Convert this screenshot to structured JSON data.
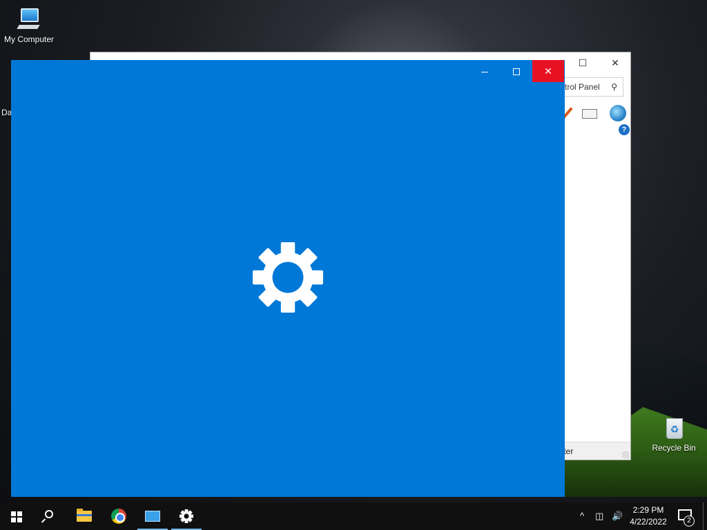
{
  "desktop": {
    "icons": [
      {
        "label": "My Computer",
        "icon": "computer-icon"
      },
      {
        "label": "Recycle Bin",
        "icon": "recycle-bin-icon"
      }
    ],
    "partial_label": "Da"
  },
  "background_window": {
    "search_text": "trol Panel",
    "search_icon": "search-icon",
    "help_label": "?",
    "status_text": "puter",
    "toolbar_icons": [
      "pen-icon",
      "envelope-icon",
      "globe-icon"
    ]
  },
  "settings_window": {
    "splash_icon": "gear-icon",
    "background_color": "#0078d7",
    "close_hover_color": "#e81123",
    "controls": [
      "minimize",
      "maximize",
      "close"
    ]
  },
  "taskbar": {
    "pinned": [
      {
        "name": "start",
        "icon": "windows-logo-icon"
      },
      {
        "name": "search",
        "icon": "search-icon"
      },
      {
        "name": "file-explorer",
        "icon": "folder-icon"
      },
      {
        "name": "chrome",
        "icon": "chrome-icon"
      },
      {
        "name": "control-panel",
        "icon": "control-panel-icon",
        "active": true
      },
      {
        "name": "settings",
        "icon": "gear-icon",
        "active": true
      }
    ],
    "tray": {
      "chevron": "^",
      "network_icon": "network-icon",
      "volume_icon": "volume-icon",
      "time": "2:29 PM",
      "date": "4/22/2022",
      "notification_count": "2"
    },
    "accent_color": "#76b9ed"
  }
}
